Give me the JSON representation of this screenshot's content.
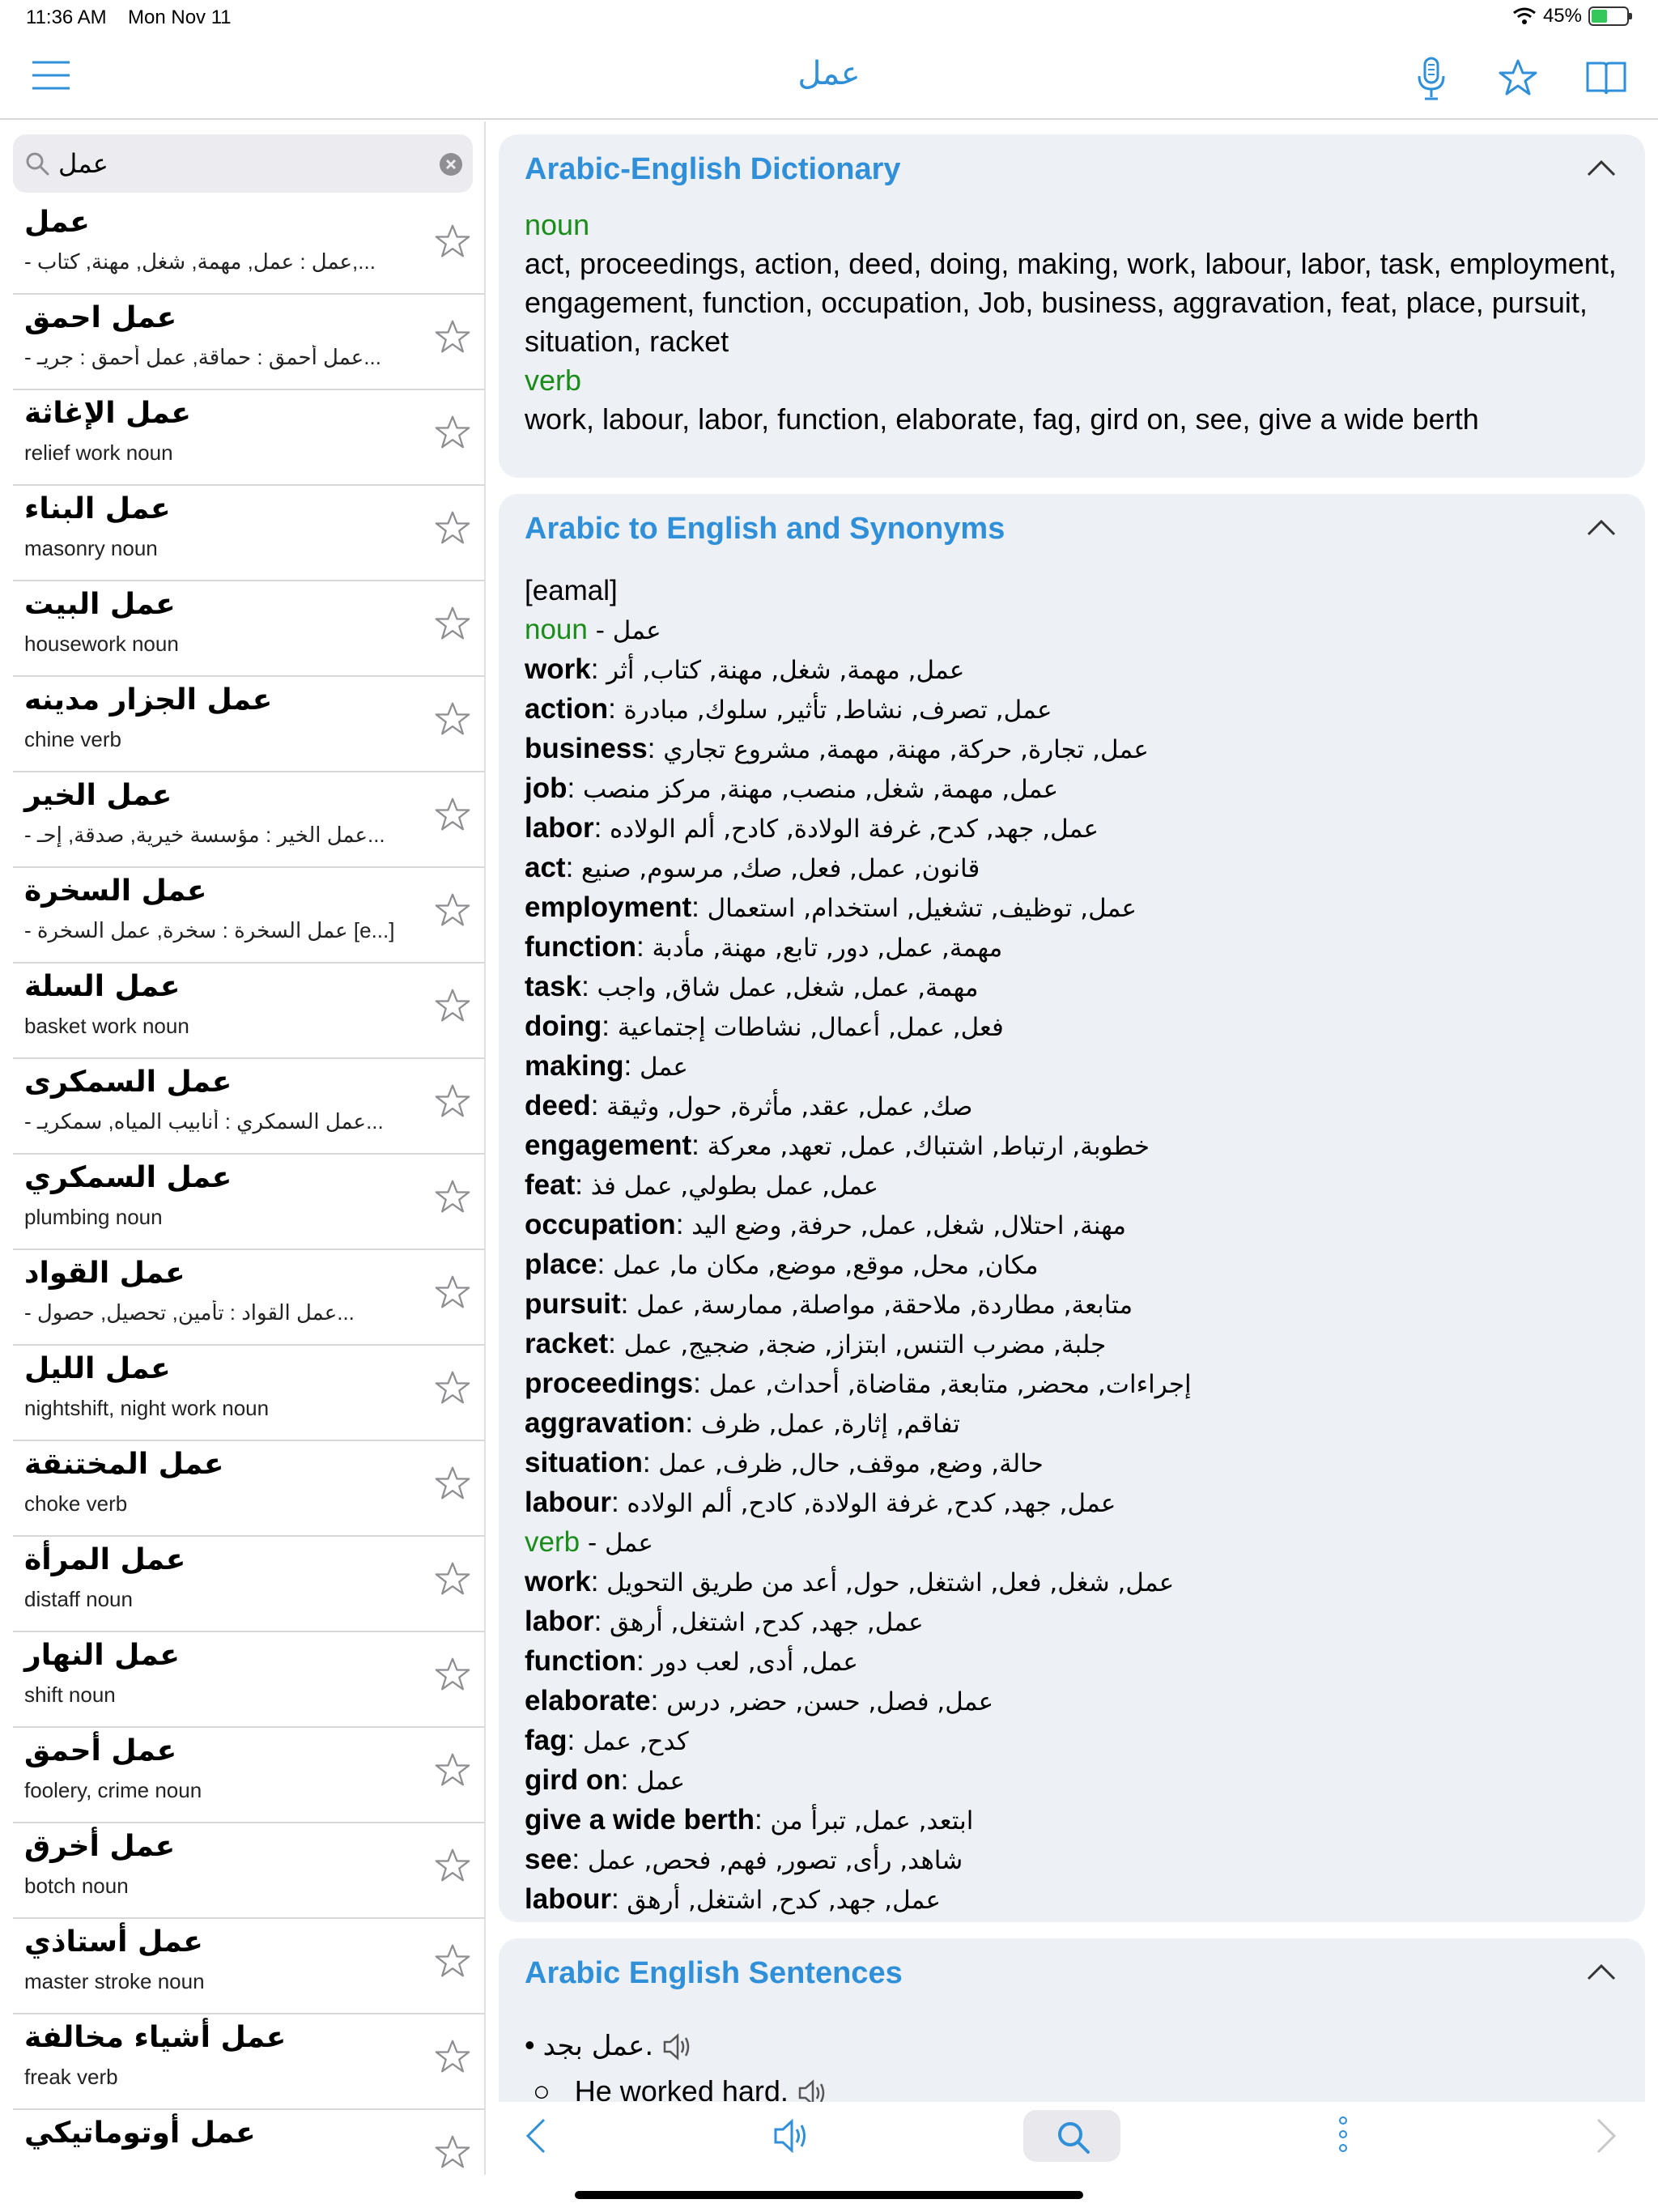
{
  "status": {
    "time": "11:36 AM",
    "date": "Mon Nov 11",
    "battery": "45%",
    "battery_level": 0.45
  },
  "nav": {
    "title": "عمل"
  },
  "search": {
    "value": "عمل"
  },
  "results": [
    {
      "title": "عمل",
      "subtitle": "- عمل : عمل, مهمة, شغل, مهنة, كتاب,..."
    },
    {
      "title": "عمل احمق",
      "subtitle": "- عمل أحمق : حماقة, عمل أحمق : جريـ..."
    },
    {
      "title": "عمل الإغاثة",
      "subtitle": "relief work noun"
    },
    {
      "title": "عمل البناء",
      "subtitle": "masonry noun"
    },
    {
      "title": "عمل البيت",
      "subtitle": "housework noun"
    },
    {
      "title": "عمل الجزار مدينه",
      "subtitle": "chine verb"
    },
    {
      "title": "عمل الخير",
      "subtitle": "- عمل الخير : مؤسسة خيرية, صدقة, إحـ..."
    },
    {
      "title": "عمل السخرة",
      "subtitle": "- عمل السخرة : سخرة, عمل السخرة [e...]"
    },
    {
      "title": "عمل السلة",
      "subtitle": "basket work noun"
    },
    {
      "title": "عمل السمكرى",
      "subtitle": "- عمل السمكري : أنابيب المياه, سمكريـ..."
    },
    {
      "title": "عمل السمكري",
      "subtitle": "plumbing noun"
    },
    {
      "title": "عمل القواد",
      "subtitle": "- عمل القواد : تأمين, تحصيل, حصول..."
    },
    {
      "title": "عمل الليل",
      "subtitle": "nightshift, night work noun"
    },
    {
      "title": "عمل المختنقة",
      "subtitle": "choke verb"
    },
    {
      "title": "عمل المرأة",
      "subtitle": "distaff noun"
    },
    {
      "title": "عمل النهار",
      "subtitle": "shift noun"
    },
    {
      "title": "عمل أحمق",
      "subtitle": "foolery, crime noun"
    },
    {
      "title": "عمل أخرق",
      "subtitle": "botch noun"
    },
    {
      "title": "عمل أستاذي",
      "subtitle": "master stroke noun"
    },
    {
      "title": "عمل أشياء مخالفة",
      "subtitle": "freak verb"
    },
    {
      "title": "عمل أوتوماتيكي",
      "subtitle": ""
    }
  ],
  "dictionary": {
    "title": "Arabic-English Dictionary",
    "noun_label": "noun",
    "noun_defs": "act, proceedings, action, deed, doing, making, work, labour, labor, task, employment, engagement, function, occupation, Job, business, aggravation, feat, place, pursuit, situation, racket",
    "verb_label": "verb",
    "verb_defs": "work, labour, labor, function, elaborate, fag, gird on, see, give a wide berth"
  },
  "synonyms": {
    "title": "Arabic to English and Synonyms",
    "pronunciation": "[eamal]",
    "noun_header": {
      "pos": "noun",
      "rest": " - عمل"
    },
    "noun_entries": [
      {
        "term": "work",
        "ar": "عمل, مهمة, شغل, مهنة, كتاب, أثر"
      },
      {
        "term": "action",
        "ar": "عمل, تصرف, نشاط, تأثير, سلوك, مبادرة"
      },
      {
        "term": "business",
        "ar": "عمل, تجارة, حركة, مهنة, مهمة, مشروع تجاري"
      },
      {
        "term": "job",
        "ar": "عمل, مهمة, شغل, منصب, مهنة, مركز منصب"
      },
      {
        "term": "labor",
        "ar": "عمل, جهد, كدح, غرفة الولادة, كادح, ألم الولاده"
      },
      {
        "term": "act",
        "ar": "قانون, عمل, فعل, صك, مرسوم, صنيع"
      },
      {
        "term": "employment",
        "ar": "عمل, توظيف, تشغيل, استخدام, استعمال"
      },
      {
        "term": "function",
        "ar": "مهمة, عمل, دور, تابع, مهنة, مأدبة"
      },
      {
        "term": "task",
        "ar": "مهمة, عمل, شغل, عمل شاق, واجب"
      },
      {
        "term": "doing",
        "ar": "فعل, عمل, أعمال, نشاطات إجتماعية"
      },
      {
        "term": "making",
        "ar": "عمل"
      },
      {
        "term": "deed",
        "ar": "صك, عمل, عقد, مأثرة, حول, وثيقة"
      },
      {
        "term": "engagement",
        "ar": "خطوبة, ارتباط, اشتباك, عمل, تعهد, معركة"
      },
      {
        "term": "feat",
        "ar": "عمل, عمل بطولي, عمل فذ"
      },
      {
        "term": "occupation",
        "ar": "مهنة, احتلال, شغل, عمل, حرفة, وضع اليد"
      },
      {
        "term": "place",
        "ar": "مكان, محل, موقع, موضع, مكان ما, عمل"
      },
      {
        "term": "pursuit",
        "ar": "متابعة, مطاردة, ملاحقة, مواصلة, ممارسة, عمل"
      },
      {
        "term": "racket",
        "ar": "جلبة, مضرب التنس, ابتزاز, ضجة, ضجيج, عمل"
      },
      {
        "term": "proceedings",
        "ar": "إجراءات, محضر, متابعة, مقاضاة, أحداث, عمل"
      },
      {
        "term": "aggravation",
        "ar": "تفاقم, إثارة, عمل, ظرف"
      },
      {
        "term": "situation",
        "ar": "حالة, وضع, موقف, حال, ظرف, عمل"
      },
      {
        "term": "labour",
        "ar": "عمل, جهد, كدح, غرفة الولادة, كادح, ألم الولاده"
      }
    ],
    "verb_header": {
      "pos": "verb",
      "rest": " - عمل"
    },
    "verb_entries": [
      {
        "term": "work",
        "ar": "عمل, شغل, فعل, اشتغل, حول, أعد من طريق التحويل"
      },
      {
        "term": "labor",
        "ar": "عمل, جهد, كدح, اشتغل, أرهق"
      },
      {
        "term": "function",
        "ar": "عمل, أدى, لعب دور"
      },
      {
        "term": "elaborate",
        "ar": "عمل, فصل, حسن, حضر, درس"
      },
      {
        "term": "fag",
        "ar": "كدح, عمل"
      },
      {
        "term": "gird on",
        "ar": "عمل"
      },
      {
        "term": "give a wide berth",
        "ar": "ابتعد, عمل, تبرأ من"
      },
      {
        "term": "see",
        "ar": "شاهد, رأى, تصور, فهم, فحص, عمل"
      },
      {
        "term": "labour",
        "ar": "عمل, جهد, كدح, اشتغل, أرهق"
      }
    ]
  },
  "sentences": {
    "title": "Arabic English Sentences",
    "items": [
      {
        "bullet": "•",
        "text": "عمل بجد."
      },
      {
        "bullet": "○",
        "text": "He worked hard."
      }
    ]
  },
  "icons": {
    "menu": "hamburger-menu-icon",
    "mic": "microphone-icon",
    "favorite": "star-icon",
    "book": "book-icon",
    "back": "chevron-left-icon",
    "speaker": "speaker-icon",
    "search": "search-icon",
    "more": "more-vertical-icon",
    "forward": "chevron-right-icon"
  },
  "colors": {
    "accent": "#2f8fd8",
    "pos_green": "#1a8c1a",
    "card_bg": "#edf0f5"
  }
}
